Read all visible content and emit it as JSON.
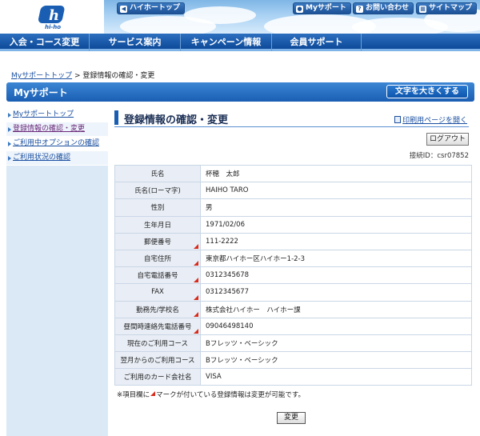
{
  "header": {
    "logo_text": "hi-ho",
    "top_links": [
      {
        "label": "ハイホートップ",
        "icon": "back-arrow-icon"
      },
      {
        "label": "Myサポート",
        "icon": "person-icon"
      },
      {
        "label": "お問い合わせ",
        "icon": "question-icon"
      },
      {
        "label": "サイトマップ",
        "icon": "sitemap-icon"
      }
    ]
  },
  "nav": {
    "items": [
      "入会・コース変更",
      "サービス案内",
      "キャンペーン情報",
      "会員サポート"
    ]
  },
  "breadcrumb": {
    "link": "Myサポートトップ",
    "separator": ">",
    "current": "登録情報の確認・変更"
  },
  "mysupport": {
    "title": "Myサポート",
    "bigtext_button": "文字を大きくする"
  },
  "sidebar": {
    "items": [
      "Myサポートトップ",
      "登録情報の確認・変更",
      "ご利用中オプションの確認",
      "ご利用状況の確認"
    ]
  },
  "main": {
    "title": "登録情報の確認・変更",
    "print_link": "印刷用ページを開く",
    "logout_button": "ログアウト",
    "connection_id": "接続ID：csr07852",
    "rows": [
      {
        "label": "氏名",
        "value": "杯穂　太郎",
        "editable": false
      },
      {
        "label": "氏名(ローマ字)",
        "value": "HAIHO TARO",
        "editable": false
      },
      {
        "label": "性別",
        "value": "男",
        "editable": false
      },
      {
        "label": "生年月日",
        "value": "1971/02/06",
        "editable": false
      },
      {
        "label": "郵便番号",
        "value": "111-2222",
        "editable": true
      },
      {
        "label": "自宅住所",
        "value": "東京都ハイホー区ハイホー1-2-3",
        "editable": true
      },
      {
        "label": "自宅電話番号",
        "value": "0312345678",
        "editable": true
      },
      {
        "label": "FAX",
        "value": "0312345677",
        "editable": true
      },
      {
        "label": "勤務先/学校名",
        "value": "株式会社ハイホー　ハイホー課",
        "editable": true
      },
      {
        "label": "昼間時連絡先電話番号",
        "value": "09046498140",
        "editable": true
      },
      {
        "label": "現在のご利用コース",
        "value": "Bフレッツ・ベーシック",
        "editable": false
      },
      {
        "label": "翌月からのご利用コース",
        "value": "Bフレッツ・ベーシック",
        "editable": false
      },
      {
        "label": "ご利用のカード会社名",
        "value": "VISA",
        "editable": false
      }
    ],
    "note_before": "※項目欄に",
    "note_after": "マークが付いている登録情報は変更が可能です。",
    "change_button": "変更"
  },
  "colors": {
    "accent": "#1a5eb3",
    "marker": "#d92b1b"
  }
}
